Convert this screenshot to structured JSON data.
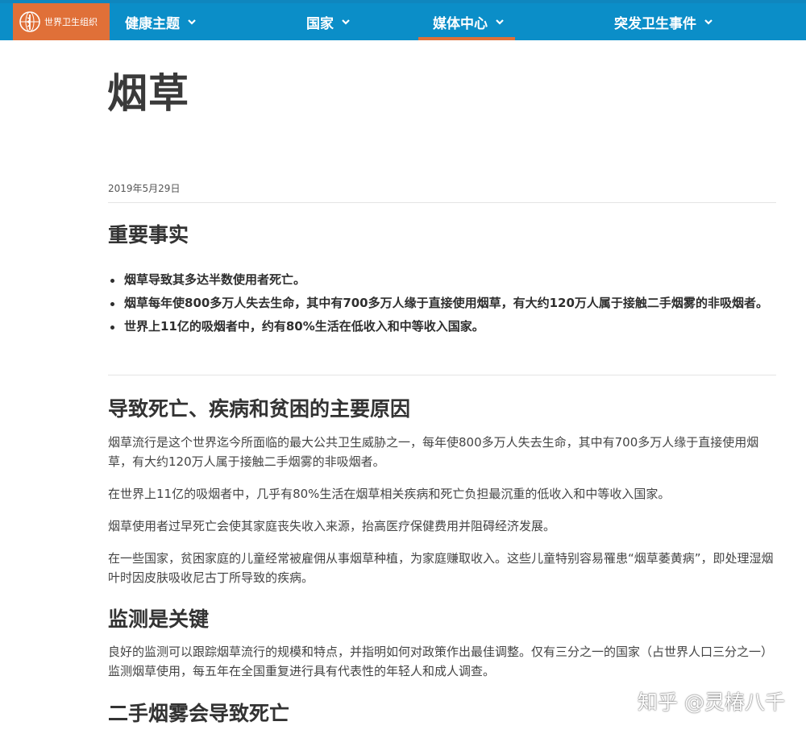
{
  "logo": {
    "text": "世界卫生组织"
  },
  "nav": [
    {
      "label": "健康主题"
    },
    {
      "label": "国家"
    },
    {
      "label": "媒体中心",
      "active": true
    },
    {
      "label": "突发卫生事件"
    }
  ],
  "colors": {
    "nav_bg": "#0b8ec8",
    "accent": "#e07038"
  },
  "page": {
    "title": "烟草",
    "date": "2019年5月29日"
  },
  "key_facts": {
    "heading": "重要事实",
    "items": [
      "烟草导致其多达半数使用者死亡。",
      "烟草每年使800多万人失去生命，其中有700多万人缘于直接使用烟草，有大约120万人属于接触二手烟雾的非吸烟者。",
      "世界上11亿的吸烟者中，约有80%生活在低收入和中等收入国家。"
    ]
  },
  "section_death": {
    "heading": "导致死亡、疾病和贫困的主要原因",
    "paragraphs": [
      "烟草流行是这个世界迄今所面临的最大公共卫生威胁之一，每年使800多万人失去生命，其中有700多万人缘于直接使用烟草，有大约120万人属于接触二手烟雾的非吸烟者。",
      "在世界上11亿的吸烟者中，几乎有80%生活在烟草相关疾病和死亡负担最沉重的低收入和中等收入国家。",
      "烟草使用者过早死亡会使其家庭丧失收入来源，抬高医疗保健费用并阻碍经济发展。",
      "在一些国家，贫困家庭的儿童经常被雇佣从事烟草种植，为家庭赚取收入。这些儿童特别容易罹患“烟草萎黄病”，即处理湿烟叶时因皮肤吸收尼古丁所导致的疾病。"
    ]
  },
  "section_monitoring": {
    "heading": "监测是关键",
    "paragraphs": [
      "良好的监测可以跟踪烟草流行的规模和特点，并指明如何对政策作出最佳调整。仅有三分之一的国家（占世界人口三分之一）监测烟草使用，每五年在全国重复进行具有代表性的年轻人和成人调查。"
    ]
  },
  "section_secondhand": {
    "heading": "二手烟雾会导致死亡"
  },
  "watermark": "知乎 @灵椿八千"
}
